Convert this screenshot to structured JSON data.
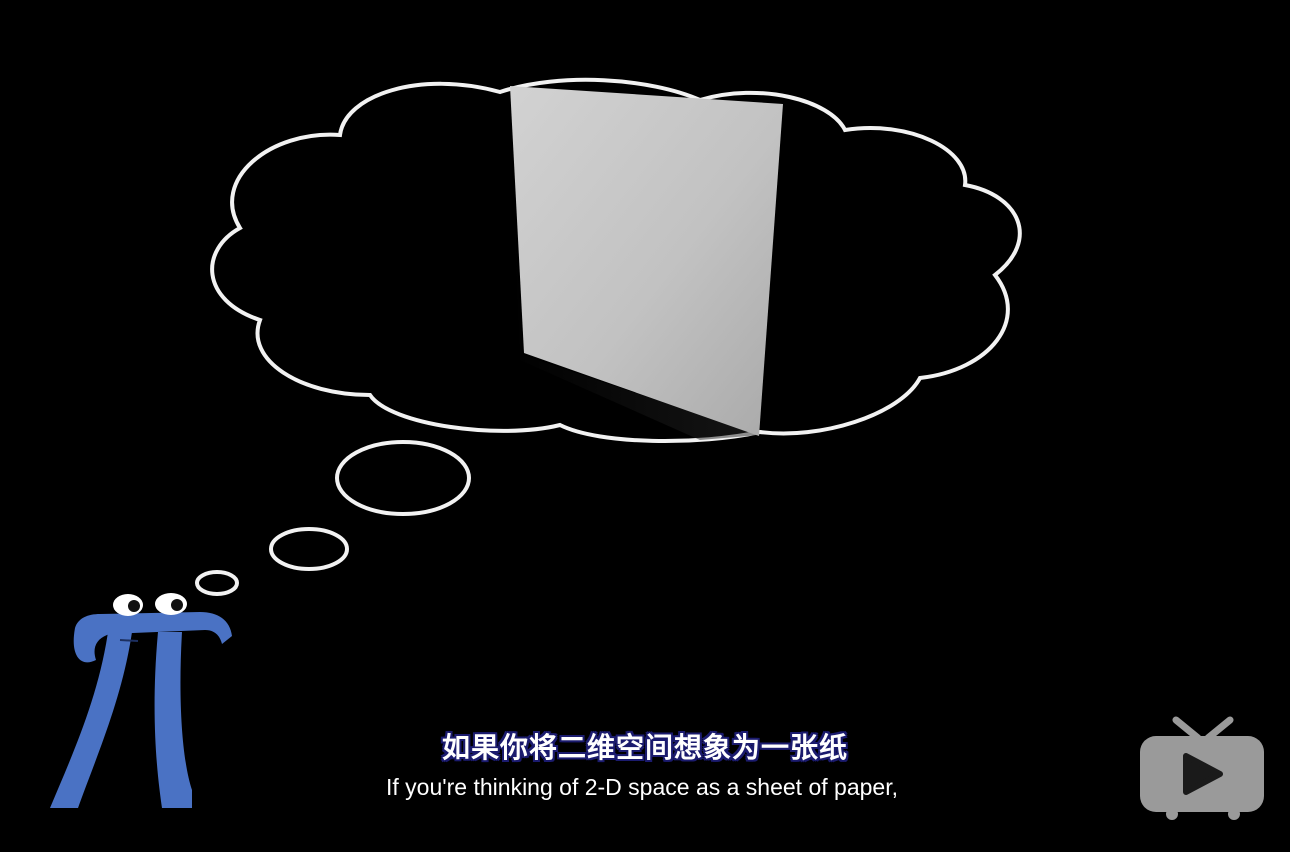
{
  "subtitles": {
    "chinese": "如果你将二维空间想象为一张纸",
    "english": "If you're thinking of 2-D space as a sheet of paper,"
  },
  "colors": {
    "background": "#000000",
    "cloud_outline": "#f2f2f2",
    "paper": "#c4c4c4",
    "pi_character": "#4a72c4",
    "subtitle_outline": "#1b1b6e",
    "logo": "#9a9a9a"
  },
  "icons": {
    "logo": "tv-play-icon"
  }
}
